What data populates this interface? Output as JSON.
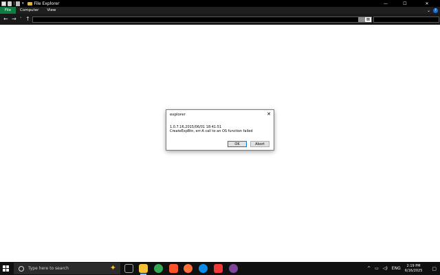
{
  "window": {
    "title": "File Explorer",
    "controls": {
      "minimize": "—",
      "maximize": "☐",
      "close": "✕"
    }
  },
  "ribbon": {
    "tabs": [
      {
        "label": "File",
        "active": true
      },
      {
        "label": "Computer"
      },
      {
        "label": "View"
      }
    ],
    "accent": "#107c41"
  },
  "nav": {
    "back": "←",
    "forward": "→",
    "recent": "˅",
    "up": "↑",
    "address_value": "",
    "search_value": ""
  },
  "dialog": {
    "title": "explorer",
    "close": "✕",
    "line1": "1.0.7.16,2015/06/01 18:41:51",
    "line2": "CreateExpBtn, err:A call to an OS function failed",
    "ok_label": "OK",
    "abort_label": "Abort"
  },
  "taskbar": {
    "search_placeholder": "Type here to search",
    "apps": [
      {
        "name": "task-view"
      },
      {
        "name": "file-explorer",
        "active": true,
        "color": "#f3c13a"
      },
      {
        "name": "chrome",
        "color": "#34a853"
      },
      {
        "name": "brave",
        "color": "#fb542b"
      },
      {
        "name": "firefox",
        "color": "#ff7139"
      },
      {
        "name": "edge",
        "color": "#0c8ce9"
      },
      {
        "name": "vivaldi",
        "color": "#ef3939"
      },
      {
        "name": "tor-browser",
        "color": "#7d4698"
      }
    ],
    "tray": {
      "chevron": "^",
      "language": "ENG",
      "time": "2:19 PM",
      "date": "6/16/2025"
    }
  }
}
